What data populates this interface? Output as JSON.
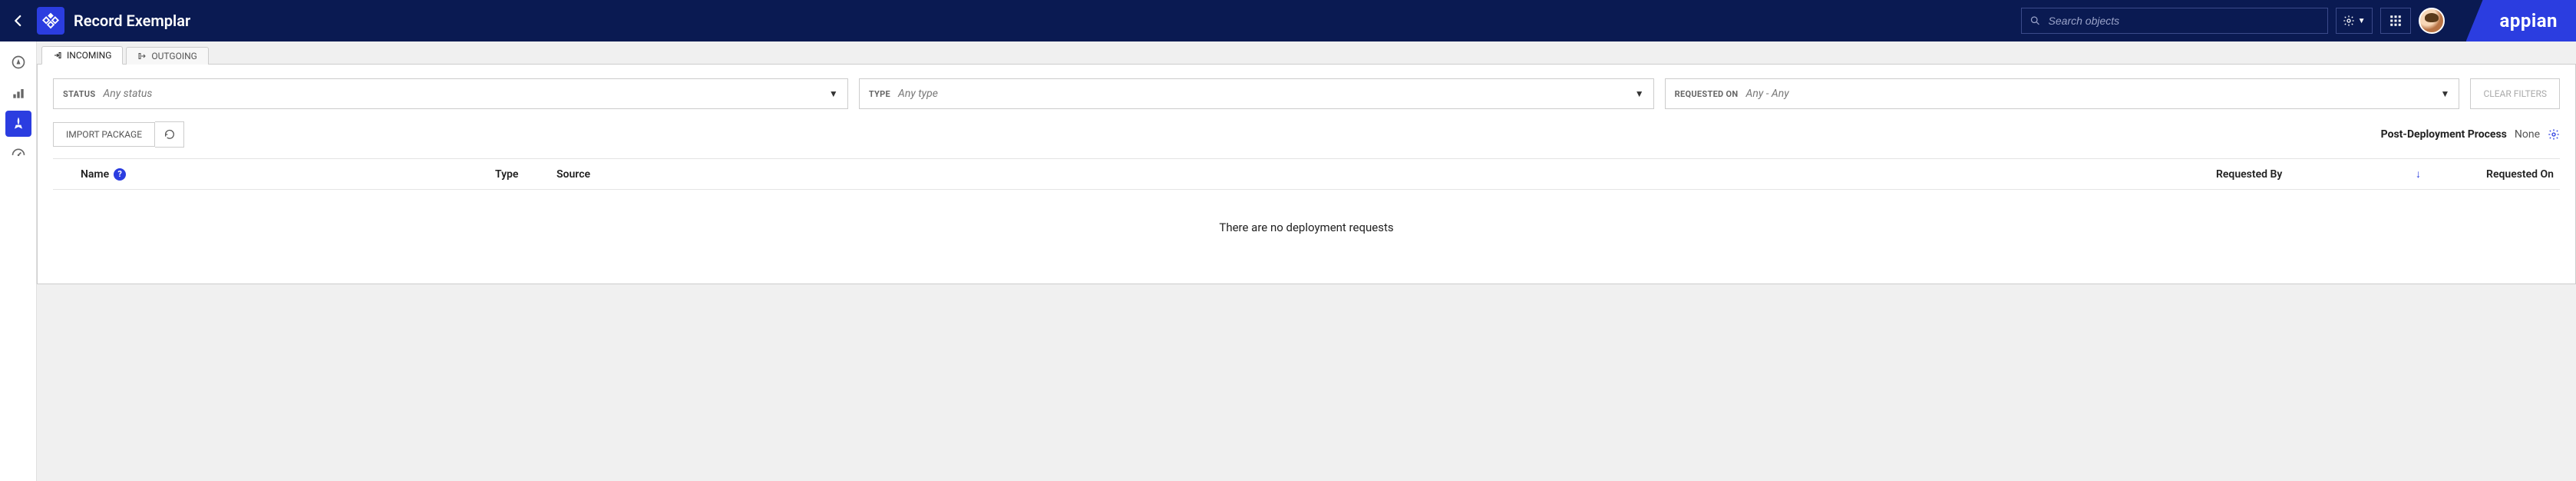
{
  "header": {
    "title": "Record Exemplar",
    "search_placeholder": "Search objects",
    "brand": "appian"
  },
  "tabs": [
    {
      "label": "INCOMING",
      "active": true
    },
    {
      "label": "OUTGOING",
      "active": false
    }
  ],
  "filters": {
    "status": {
      "label": "STATUS",
      "value": "Any status"
    },
    "type": {
      "label": "TYPE",
      "value": "Any type"
    },
    "requested_on": {
      "label": "REQUESTED ON",
      "value": "Any - Any"
    },
    "clear_label": "CLEAR FILTERS"
  },
  "toolbar": {
    "import_label": "IMPORT PACKAGE",
    "post_deploy_label": "Post-Deployment Process",
    "post_deploy_value": "None"
  },
  "grid": {
    "columns": {
      "name": "Name",
      "type": "Type",
      "source": "Source",
      "requested_by": "Requested By",
      "requested_on": "Requested On"
    },
    "rows": [],
    "empty_message": "There are no deployment requests"
  }
}
